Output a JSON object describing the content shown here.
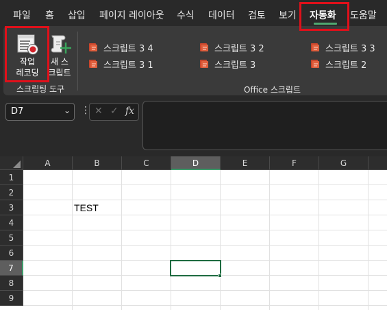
{
  "menu": {
    "tabs": [
      {
        "label": "파일"
      },
      {
        "label": "홈"
      },
      {
        "label": "삽입"
      },
      {
        "label": "페이지 레이아웃"
      },
      {
        "label": "수식"
      },
      {
        "label": "데이터"
      },
      {
        "label": "검토"
      },
      {
        "label": "보기"
      },
      {
        "label": "자동화",
        "active": true
      },
      {
        "label": "도움말"
      }
    ]
  },
  "ribbon": {
    "groups": {
      "scripting_tools": {
        "label": "스크립팅 도구",
        "record_actions": {
          "line1": "작업",
          "line2": "레코딩",
          "icon": "record-actions-icon"
        },
        "new_script": {
          "line1": "새 스",
          "line2": "크립트",
          "icon": "new-script-icon"
        }
      },
      "office_scripts": {
        "label": "Office 스크립트",
        "scripts": [
          {
            "label": "스크립트 3 4",
            "icon": "script-icon"
          },
          {
            "label": "스크립트 3 2",
            "icon": "script-icon"
          },
          {
            "label": "스크립트 3 3",
            "icon": "script-icon"
          },
          {
            "label": "스크립트 3 1",
            "icon": "script-icon"
          },
          {
            "label": "스크립트 3",
            "icon": "script-icon"
          },
          {
            "label": "스크립트 2",
            "icon": "script-icon"
          }
        ]
      }
    }
  },
  "formula_bar": {
    "name_box": "D7",
    "cancel_icon": "✕",
    "confirm_icon": "✓",
    "function_icon": "fx",
    "formula": ""
  },
  "sheet": {
    "columns": [
      "A",
      "B",
      "C",
      "D",
      "E",
      "F",
      "G"
    ],
    "rows": [
      "1",
      "2",
      "3",
      "4",
      "5",
      "6",
      "7",
      "8",
      "9"
    ],
    "selected_cell": "D7",
    "cells": {
      "B3": "TEST"
    }
  },
  "colors": {
    "highlight_box": "#e0101a",
    "active_accent": "#4fa870",
    "cell_selection": "#1e6b40"
  }
}
